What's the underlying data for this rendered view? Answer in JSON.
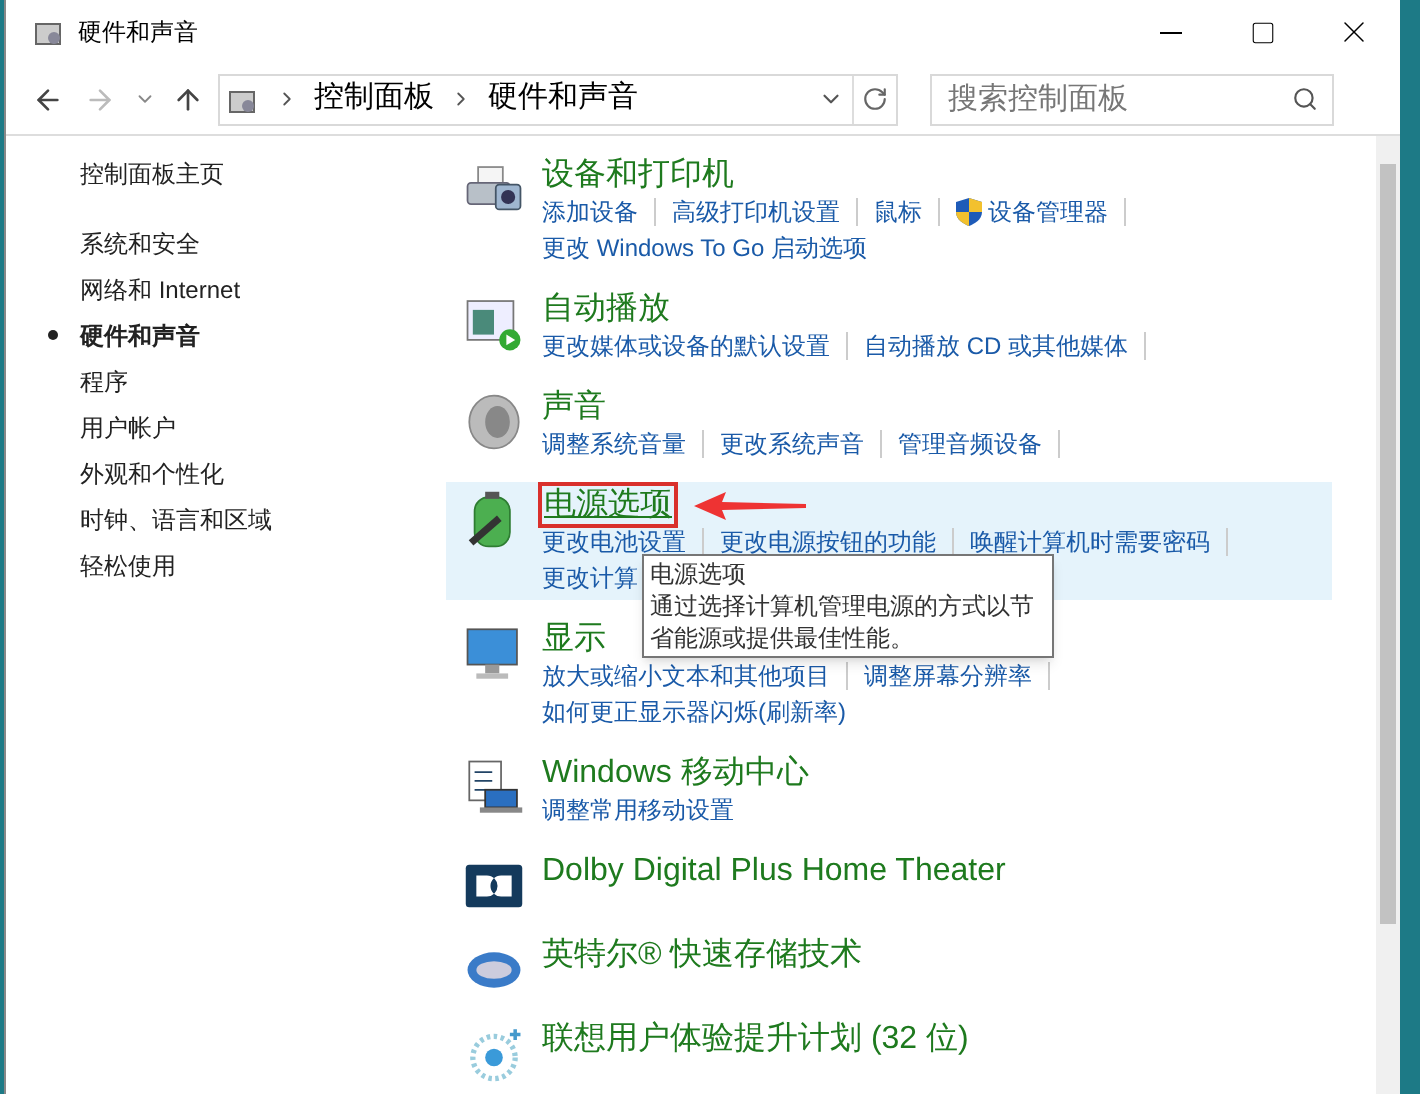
{
  "window": {
    "title": "硬件和声音"
  },
  "address": {
    "segments": [
      "控制面板",
      "硬件和声音"
    ]
  },
  "search": {
    "placeholder": "搜索控制面板"
  },
  "sidebar": {
    "home": "控制面板主页",
    "items": [
      {
        "label": "系统和安全",
        "selected": false
      },
      {
        "label": "网络和 Internet",
        "selected": false
      },
      {
        "label": "硬件和声音",
        "selected": true
      },
      {
        "label": "程序",
        "selected": false
      },
      {
        "label": "用户帐户",
        "selected": false
      },
      {
        "label": "外观和个性化",
        "selected": false
      },
      {
        "label": "时钟、语言和区域",
        "selected": false
      },
      {
        "label": "轻松使用",
        "selected": false
      }
    ]
  },
  "categories": [
    {
      "title": "设备和打印机",
      "highlighted": false,
      "links": [
        [
          {
            "text": "添加设备",
            "shield": false
          },
          {
            "text": "高级打印机设置",
            "shield": false
          },
          {
            "text": "鼠标",
            "shield": false
          },
          {
            "text": "设备管理器",
            "shield": true
          }
        ],
        [
          {
            "text": "更改 Windows To Go 启动选项",
            "shield": false
          }
        ]
      ]
    },
    {
      "title": "自动播放",
      "highlighted": false,
      "links": [
        [
          {
            "text": "更改媒体或设备的默认设置",
            "shield": false
          },
          {
            "text": "自动播放 CD 或其他媒体",
            "shield": false
          }
        ]
      ]
    },
    {
      "title": "声音",
      "highlighted": false,
      "links": [
        [
          {
            "text": "调整系统音量",
            "shield": false
          },
          {
            "text": "更改系统声音",
            "shield": false
          },
          {
            "text": "管理音频设备",
            "shield": false
          }
        ]
      ]
    },
    {
      "title": "电源选项",
      "highlighted": true,
      "tooltip": {
        "title": "电源选项",
        "text": "通过选择计算机管理电源的方式以节省能源或提供最佳性能。"
      },
      "links": [
        [
          {
            "text": "更改电池设置",
            "shield": false
          },
          {
            "text": "更改电源按钮的功能",
            "shield": false
          },
          {
            "text": "唤醒计算机时需要密码",
            "shield": false
          }
        ],
        [
          {
            "text": "更改计算",
            "shield": false
          }
        ]
      ]
    },
    {
      "title": "显示",
      "highlighted": false,
      "links": [
        [
          {
            "text": "放大或缩小文本和其他项目",
            "shield": false
          },
          {
            "text": "调整屏幕分辨率",
            "shield": false
          }
        ],
        [
          {
            "text": "如何更正显示器闪烁(刷新率)",
            "shield": false
          }
        ]
      ]
    },
    {
      "title": "Windows 移动中心",
      "highlighted": false,
      "links": [
        [
          {
            "text": "调整常用移动设置",
            "shield": false
          }
        ]
      ]
    },
    {
      "title": "Dolby Digital Plus Home Theater",
      "highlighted": false
    },
    {
      "title": "英特尔® 快速存储技术",
      "highlighted": false
    },
    {
      "title": "联想用户体验提升计划 (32 位)",
      "highlighted": false
    }
  ]
}
